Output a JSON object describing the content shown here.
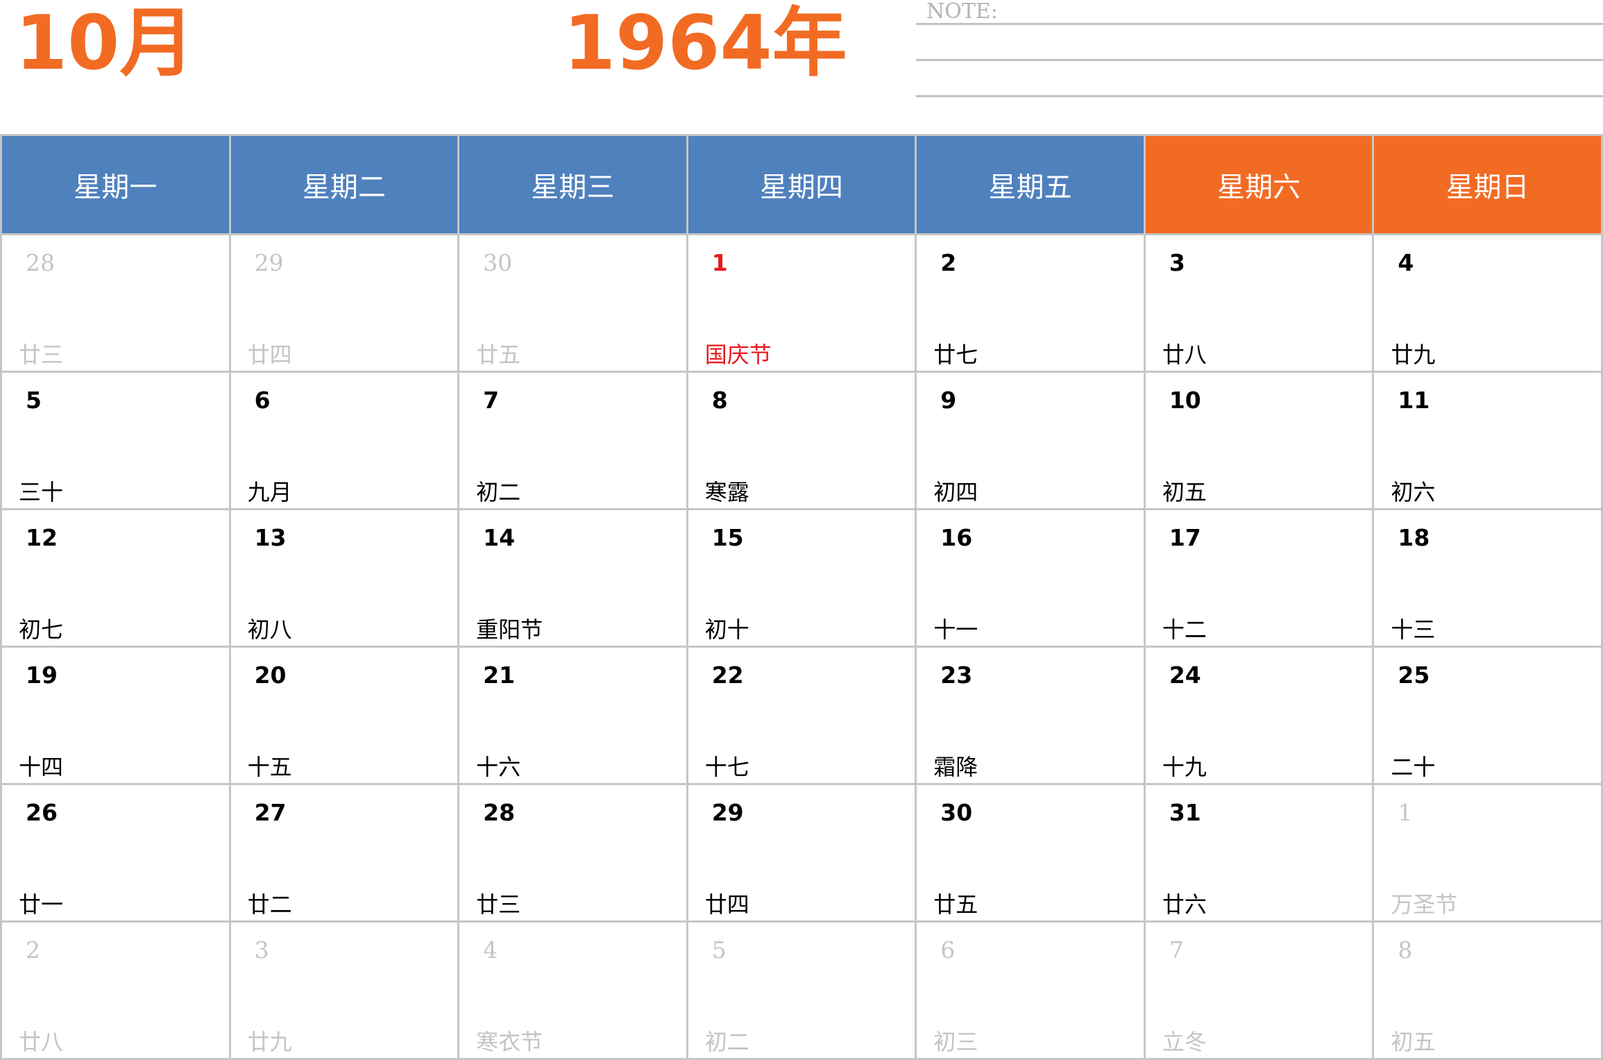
{
  "header": {
    "month": "10月",
    "year": "1964年",
    "note_label": "NOTE:"
  },
  "colors": {
    "accent": "#f26b23",
    "weekday_header_bg": "#4f81bd",
    "weekend_header_bg": "#f26b23",
    "holiday_text": "#e8191c",
    "muted_text": "#c4c4c4",
    "grid_line": "#c6c6c6"
  },
  "weekdays": [
    {
      "label": "星期一",
      "weekend": false
    },
    {
      "label": "星期二",
      "weekend": false
    },
    {
      "label": "星期三",
      "weekend": false
    },
    {
      "label": "星期四",
      "weekend": false
    },
    {
      "label": "星期五",
      "weekend": false
    },
    {
      "label": "星期六",
      "weekend": true
    },
    {
      "label": "星期日",
      "weekend": true
    }
  ],
  "weeks": [
    [
      {
        "day": "28",
        "lunar": "廿三",
        "current": false,
        "holiday": false
      },
      {
        "day": "29",
        "lunar": "廿四",
        "current": false,
        "holiday": false
      },
      {
        "day": "30",
        "lunar": "廿五",
        "current": false,
        "holiday": false
      },
      {
        "day": "1",
        "lunar": "国庆节",
        "current": true,
        "holiday": true
      },
      {
        "day": "2",
        "lunar": "廿七",
        "current": true,
        "holiday": false
      },
      {
        "day": "3",
        "lunar": "廿八",
        "current": true,
        "holiday": false
      },
      {
        "day": "4",
        "lunar": "廿九",
        "current": true,
        "holiday": false
      }
    ],
    [
      {
        "day": "5",
        "lunar": "三十",
        "current": true,
        "holiday": false
      },
      {
        "day": "6",
        "lunar": "九月",
        "current": true,
        "holiday": false
      },
      {
        "day": "7",
        "lunar": "初二",
        "current": true,
        "holiday": false
      },
      {
        "day": "8",
        "lunar": "寒露",
        "current": true,
        "holiday": false
      },
      {
        "day": "9",
        "lunar": "初四",
        "current": true,
        "holiday": false
      },
      {
        "day": "10",
        "lunar": "初五",
        "current": true,
        "holiday": false
      },
      {
        "day": "11",
        "lunar": "初六",
        "current": true,
        "holiday": false
      }
    ],
    [
      {
        "day": "12",
        "lunar": "初七",
        "current": true,
        "holiday": false
      },
      {
        "day": "13",
        "lunar": "初八",
        "current": true,
        "holiday": false
      },
      {
        "day": "14",
        "lunar": "重阳节",
        "current": true,
        "holiday": false
      },
      {
        "day": "15",
        "lunar": "初十",
        "current": true,
        "holiday": false
      },
      {
        "day": "16",
        "lunar": "十一",
        "current": true,
        "holiday": false
      },
      {
        "day": "17",
        "lunar": "十二",
        "current": true,
        "holiday": false
      },
      {
        "day": "18",
        "lunar": "十三",
        "current": true,
        "holiday": false
      }
    ],
    [
      {
        "day": "19",
        "lunar": "十四",
        "current": true,
        "holiday": false
      },
      {
        "day": "20",
        "lunar": "十五",
        "current": true,
        "holiday": false
      },
      {
        "day": "21",
        "lunar": "十六",
        "current": true,
        "holiday": false
      },
      {
        "day": "22",
        "lunar": "十七",
        "current": true,
        "holiday": false
      },
      {
        "day": "23",
        "lunar": "霜降",
        "current": true,
        "holiday": false
      },
      {
        "day": "24",
        "lunar": "十九",
        "current": true,
        "holiday": false
      },
      {
        "day": "25",
        "lunar": "二十",
        "current": true,
        "holiday": false
      }
    ],
    [
      {
        "day": "26",
        "lunar": "廿一",
        "current": true,
        "holiday": false
      },
      {
        "day": "27",
        "lunar": "廿二",
        "current": true,
        "holiday": false
      },
      {
        "day": "28",
        "lunar": "廿三",
        "current": true,
        "holiday": false
      },
      {
        "day": "29",
        "lunar": "廿四",
        "current": true,
        "holiday": false
      },
      {
        "day": "30",
        "lunar": "廿五",
        "current": true,
        "holiday": false
      },
      {
        "day": "31",
        "lunar": "廿六",
        "current": true,
        "holiday": false
      },
      {
        "day": "1",
        "lunar": "万圣节",
        "current": false,
        "holiday": false
      }
    ],
    [
      {
        "day": "2",
        "lunar": "廿八",
        "current": false,
        "holiday": false
      },
      {
        "day": "3",
        "lunar": "廿九",
        "current": false,
        "holiday": false
      },
      {
        "day": "4",
        "lunar": "寒衣节",
        "current": false,
        "holiday": false
      },
      {
        "day": "5",
        "lunar": "初二",
        "current": false,
        "holiday": false
      },
      {
        "day": "6",
        "lunar": "初三",
        "current": false,
        "holiday": false
      },
      {
        "day": "7",
        "lunar": "立冬",
        "current": false,
        "holiday": false
      },
      {
        "day": "8",
        "lunar": "初五",
        "current": false,
        "holiday": false
      }
    ]
  ]
}
